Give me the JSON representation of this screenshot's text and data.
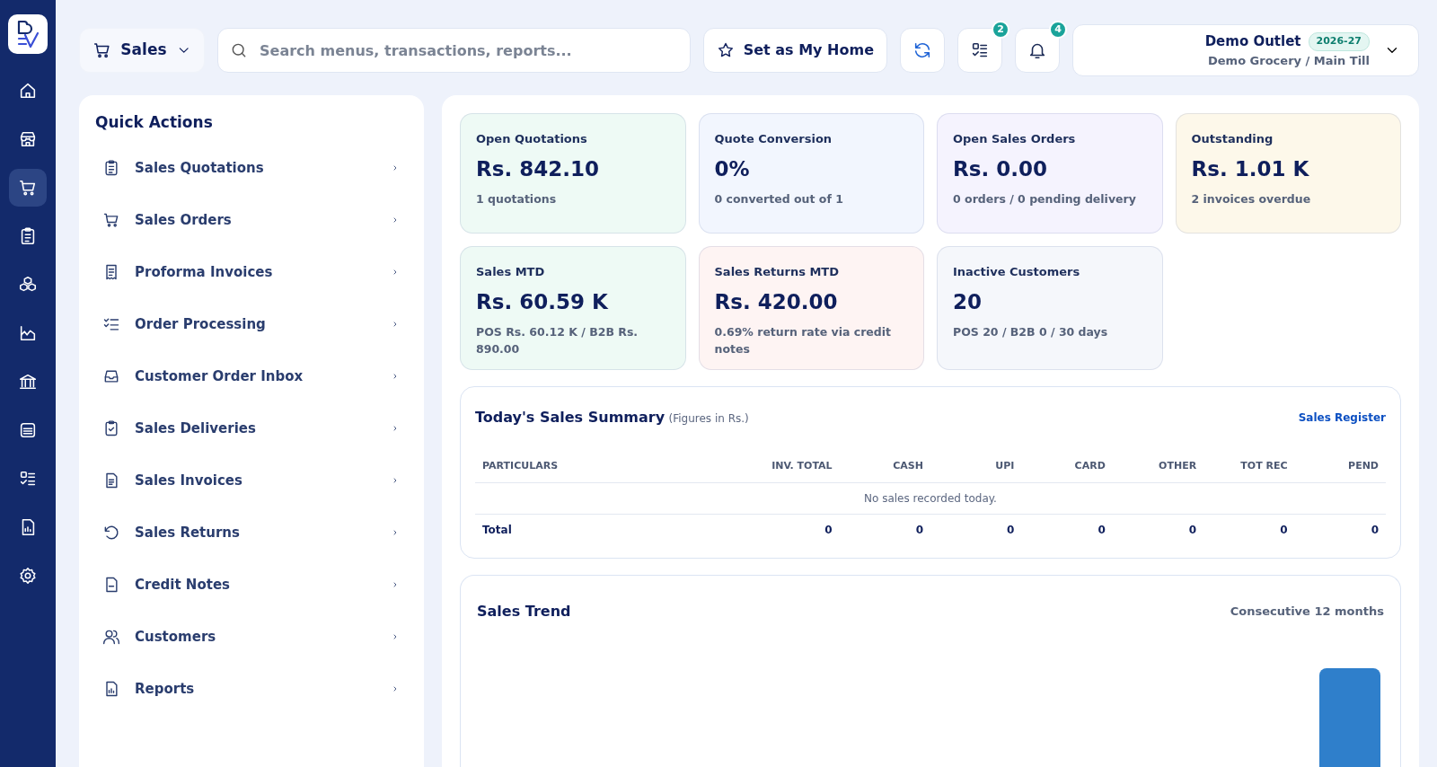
{
  "sidebar": {
    "items": [
      {
        "selected": false
      },
      {
        "selected": false
      },
      {
        "selected": true
      },
      {
        "selected": false
      },
      {
        "selected": false
      },
      {
        "selected": false
      },
      {
        "selected": false
      },
      {
        "selected": false
      },
      {
        "selected": false
      },
      {
        "selected": false
      },
      {
        "selected": false
      }
    ]
  },
  "topbar": {
    "module": "Sales",
    "search": {
      "placeholder": "Search menus, transactions, reports..."
    },
    "home_button": "Set as My Home",
    "tasks_badge": "2",
    "notifications_badge": "4",
    "outlet": {
      "name": "Demo Outlet",
      "year": "2026-27",
      "subtitle": "Demo Grocery / Main Till"
    }
  },
  "quick_actions": {
    "title": "Quick Actions",
    "items": [
      {
        "label": "Sales Quotations"
      },
      {
        "label": "Sales Orders"
      },
      {
        "label": "Proforma Invoices"
      },
      {
        "label": "Order Processing"
      },
      {
        "label": "Customer Order Inbox"
      },
      {
        "label": "Sales Deliveries"
      },
      {
        "label": "Sales Invoices"
      },
      {
        "label": "Sales Returns"
      },
      {
        "label": "Credit Notes"
      },
      {
        "label": "Customers"
      },
      {
        "label": "Reports"
      }
    ]
  },
  "kpis": [
    {
      "title": "Open Quotations",
      "value": "Rs. 842.10",
      "note": "1 quotations",
      "color": "#eefaf5"
    },
    {
      "title": "Quote Conversion",
      "value": "0%",
      "note": "0 converted out of 1",
      "color": "#f2f6fe"
    },
    {
      "title": "Open Sales Orders",
      "value": "Rs. 0.00",
      "note": "0 orders / 0 pending delivery",
      "color": "#f5f3fe"
    },
    {
      "title": "Outstanding",
      "value": "Rs. 1.01 K",
      "note": "2 invoices overdue",
      "color": "#fdf8ea"
    },
    {
      "title": "Sales MTD",
      "value": "Rs. 60.59 K",
      "note": "POS Rs. 60.12 K / B2B Rs. 890.00",
      "color": "#eefaf5"
    },
    {
      "title": "Sales Returns MTD",
      "value": "Rs. 420.00",
      "note": "0.69% return rate via credit notes",
      "color": "#fef4f3"
    },
    {
      "title": "Inactive Customers",
      "value": "20",
      "note": "POS 20 / B2B 0 / 30 days",
      "color": "#f5f7fb"
    }
  ],
  "summary": {
    "title": "Today's Sales Summary",
    "subtitle": "(Figures in Rs.)",
    "link": "Sales Register",
    "columns": [
      "PARTICULARS",
      "INV. TOTAL",
      "CASH",
      "UPI",
      "CARD",
      "OTHER",
      "TOT REC",
      "PEND"
    ],
    "empty_message": "No sales recorded today.",
    "total_row": [
      "Total",
      "0",
      "0",
      "0",
      "0",
      "0",
      "0",
      "0"
    ]
  },
  "trend": {
    "title": "Sales Trend",
    "subtitle": "Consecutive 12 months"
  }
}
